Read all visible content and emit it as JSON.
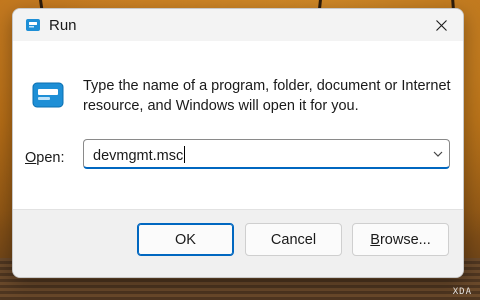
{
  "window": {
    "title": "Run",
    "close_icon": "close-icon"
  },
  "description": "Type the name of a program, folder, document or Internet resource, and Windows will open it for you.",
  "open_field": {
    "label_accel": "O",
    "label_rest": "pen:",
    "value": "devmgmt.msc"
  },
  "buttons": {
    "ok": "OK",
    "cancel": "Cancel",
    "browse_accel": "B",
    "browse_rest": "rowse..."
  },
  "watermark": "XDA",
  "colors": {
    "accent": "#0067c0",
    "run_icon": "#1e8fd6"
  }
}
